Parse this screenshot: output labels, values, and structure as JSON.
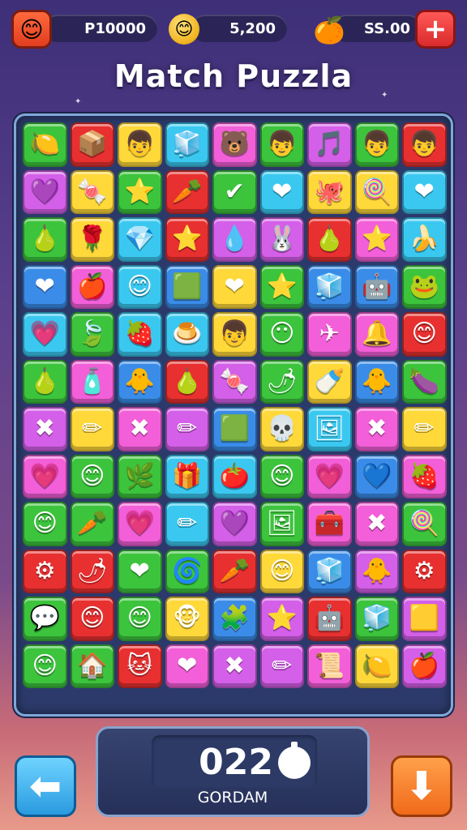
{
  "hud": {
    "avatar_icon": "smiley-face-icon",
    "score_label": "P10000",
    "coins_label": "5,200",
    "coin_icon": "smiley-coin-icon",
    "fruit_icon": "orange-fruit-icon",
    "currency_label": "SS.00",
    "plus_icon": "plus-icon"
  },
  "title": "Match Puzzla",
  "board": {
    "tiles": [
      {
        "color": "#3cc43c",
        "glyph": "🍋",
        "icon": "lemon-icon"
      },
      {
        "color": "#e83030",
        "glyph": "📦",
        "icon": "gift-box-icon"
      },
      {
        "color": "#ffd83a",
        "glyph": "👦",
        "icon": "boy-face-icon"
      },
      {
        "color": "#3ac8f0",
        "glyph": "🧊",
        "icon": "ice-cube-icon"
      },
      {
        "color": "#f25fd8",
        "glyph": "🐻",
        "icon": "bear-icon"
      },
      {
        "color": "#3cc43c",
        "glyph": "👦",
        "icon": "boy-face-icon"
      },
      {
        "color": "#d45fe8",
        "glyph": "🎵",
        "icon": "music-note-icon"
      },
      {
        "color": "#3cc43c",
        "glyph": "👦",
        "icon": "boy-face-icon"
      },
      {
        "color": "#e83030",
        "glyph": "👦",
        "icon": "boy-face-icon"
      },
      {
        "color": "#d45fe8",
        "glyph": "💜",
        "icon": "purple-heart-icon"
      },
      {
        "color": "#ffd83a",
        "glyph": "🍬",
        "icon": "candy-icon"
      },
      {
        "color": "#3cc43c",
        "glyph": "⭐",
        "icon": "star-icon"
      },
      {
        "color": "#e83030",
        "glyph": "🥕",
        "icon": "carrot-icon"
      },
      {
        "color": "#3cc43c",
        "glyph": "✔",
        "icon": "check-icon"
      },
      {
        "color": "#3ac8f0",
        "glyph": "❤",
        "icon": "heart-icon"
      },
      {
        "color": "#ffd83a",
        "glyph": "🐙",
        "icon": "octopus-icon"
      },
      {
        "color": "#ffd83a",
        "glyph": "🍭",
        "icon": "lollipop-icon"
      },
      {
        "color": "#3ac8f0",
        "glyph": "❤",
        "icon": "heart-icon"
      },
      {
        "color": "#3cc43c",
        "glyph": "🍐",
        "icon": "pear-icon",
        "tall": false
      },
      {
        "color": "#ffd83a",
        "glyph": "🌹",
        "icon": "flower-pot-icon"
      },
      {
        "color": "#3ac8f0",
        "glyph": "💎",
        "icon": "gem-icon"
      },
      {
        "color": "#e83030",
        "glyph": "⭐",
        "icon": "star-icon"
      },
      {
        "color": "#d45fe8",
        "glyph": "💧",
        "icon": "drop-icon"
      },
      {
        "color": "#d45fe8",
        "glyph": "🐰",
        "icon": "bunny-icon"
      },
      {
        "color": "#e83030",
        "glyph": "🍐",
        "icon": "pear-icon"
      },
      {
        "color": "#f25fd8",
        "glyph": "⭐",
        "icon": "star-icon"
      },
      {
        "color": "#3ac8f0",
        "glyph": "🍌",
        "icon": "banana-icon"
      },
      {
        "color": "#3a8ce8",
        "glyph": "❤",
        "icon": "heart-icon"
      },
      {
        "color": "#f25fd8",
        "glyph": "🍎",
        "icon": "apple-icon"
      },
      {
        "color": "#3ac8f0",
        "glyph": "😊",
        "icon": "smiley-face-icon"
      },
      {
        "color": "#3a8ce8",
        "glyph": "🟩",
        "icon": "square-icon"
      },
      {
        "color": "#ffd83a",
        "glyph": "❤",
        "icon": "heart-icon"
      },
      {
        "color": "#3cc43c",
        "glyph": "⭐",
        "icon": "star-icon"
      },
      {
        "color": "#3a8ce8",
        "glyph": "🧊",
        "icon": "cube-icon"
      },
      {
        "color": "#3a8ce8",
        "glyph": "🤖",
        "icon": "robot-face-icon"
      },
      {
        "color": "#3cc43c",
        "glyph": "🐸",
        "icon": "frog-icon"
      },
      {
        "color": "#3ac8f0",
        "glyph": "💗",
        "icon": "pink-heart-icon"
      },
      {
        "color": "#3cc43c",
        "glyph": "🍃",
        "icon": "leaf-icon"
      },
      {
        "color": "#3ac8f0",
        "glyph": "🍓",
        "icon": "strawberry-icon"
      },
      {
        "color": "#3ac8f0",
        "glyph": "🍮",
        "icon": "jelly-icon"
      },
      {
        "color": "#ffd83a",
        "glyph": "👦",
        "icon": "boy-face-icon"
      },
      {
        "color": "#3cc43c",
        "glyph": "😶",
        "icon": "block-face-icon"
      },
      {
        "color": "#f25fd8",
        "glyph": "✈",
        "icon": "paper-plane-icon"
      },
      {
        "color": "#f25fd8",
        "glyph": "🔔",
        "icon": "bell-icon"
      },
      {
        "color": "#e83030",
        "glyph": "😊",
        "icon": "smiley-face-icon"
      },
      {
        "color": "#3cc43c",
        "glyph": "🍐",
        "icon": "pear-icon"
      },
      {
        "color": "#f25fd8",
        "glyph": "🧴",
        "icon": "bottle-icon"
      },
      {
        "color": "#3a8ce8",
        "glyph": "🐥",
        "icon": "chick-icon"
      },
      {
        "color": "#e83030",
        "glyph": "🍐",
        "icon": "pear-icon"
      },
      {
        "color": "#d45fe8",
        "glyph": "🍬",
        "icon": "candy-icon"
      },
      {
        "color": "#3cc43c",
        "glyph": "🌶",
        "icon": "pepper-icon"
      },
      {
        "color": "#ffd83a",
        "glyph": "🍼",
        "icon": "bottle-icon"
      },
      {
        "color": "#3a8ce8",
        "glyph": "🐥",
        "icon": "chick-icon"
      },
      {
        "color": "#3cc43c",
        "glyph": "🍆",
        "icon": "eggplant-icon"
      },
      {
        "color": "#d45fe8",
        "glyph": "✖",
        "icon": "cross-icon"
      },
      {
        "color": "#ffd83a",
        "glyph": "✏",
        "icon": "pencil-icon"
      },
      {
        "color": "#f25fd8",
        "glyph": "✖",
        "icon": "cross-icon"
      },
      {
        "color": "#d45fe8",
        "glyph": "✏",
        "icon": "pencil-icon"
      },
      {
        "color": "#3a8ce8",
        "glyph": "🟩",
        "icon": "square-icon"
      },
      {
        "color": "#ffd83a",
        "glyph": "💀",
        "icon": "skull-icon"
      },
      {
        "color": "#3ac8f0",
        "glyph": "🖼",
        "icon": "picture-icon"
      },
      {
        "color": "#f25fd8",
        "glyph": "✖",
        "icon": "cross-icon"
      },
      {
        "color": "#ffd83a",
        "glyph": "✏",
        "icon": "pencil-icon"
      },
      {
        "color": "#f25fd8",
        "glyph": "💗",
        "icon": "pink-heart-icon"
      },
      {
        "color": "#3cc43c",
        "glyph": "😊",
        "icon": "smiley-face-icon"
      },
      {
        "color": "#3cc43c",
        "glyph": "🌿",
        "icon": "herb-icon"
      },
      {
        "color": "#3ac8f0",
        "glyph": "🎁",
        "icon": "gift-icon"
      },
      {
        "color": "#3ac8f0",
        "glyph": "🍅",
        "icon": "tomato-icon"
      },
      {
        "color": "#3cc43c",
        "glyph": "😊",
        "icon": "smiley-face-icon"
      },
      {
        "color": "#f25fd8",
        "glyph": "💗",
        "icon": "pink-heart-icon"
      },
      {
        "color": "#3a8ce8",
        "glyph": "💙",
        "icon": "blue-heart-icon"
      },
      {
        "color": "#f25fd8",
        "glyph": "🍓",
        "icon": "strawberry-icon"
      },
      {
        "color": "#3cc43c",
        "glyph": "😊",
        "icon": "smiley-face-icon"
      },
      {
        "color": "#3cc43c",
        "glyph": "🥕",
        "icon": "carrot-icon"
      },
      {
        "color": "#f25fd8",
        "glyph": "💗",
        "icon": "pink-heart-icon"
      },
      {
        "color": "#3ac8f0",
        "glyph": "✏",
        "icon": "pencil-icon"
      },
      {
        "color": "#d45fe8",
        "glyph": "💜",
        "icon": "purple-heart-icon"
      },
      {
        "color": "#3cc43c",
        "glyph": "🖼",
        "icon": "frame-icon"
      },
      {
        "color": "#f25fd8",
        "glyph": "🧰",
        "icon": "box-icon"
      },
      {
        "color": "#f25fd8",
        "glyph": "✖",
        "icon": "cross-icon"
      },
      {
        "color": "#3cc43c",
        "glyph": "🍭",
        "icon": "lollipop-icon"
      },
      {
        "color": "#e83030",
        "glyph": "⚙",
        "icon": "gear-icon"
      },
      {
        "color": "#e83030",
        "glyph": "🌶",
        "icon": "pepper-icon"
      },
      {
        "color": "#3cc43c",
        "glyph": "❤",
        "icon": "heart-icon"
      },
      {
        "color": "#3cc43c",
        "glyph": "🌀",
        "icon": "swirl-icon"
      },
      {
        "color": "#e83030",
        "glyph": "🥕",
        "icon": "carrot-icon"
      },
      {
        "color": "#ffd83a",
        "glyph": "😊",
        "icon": "smiley-face-icon"
      },
      {
        "color": "#3a8ce8",
        "glyph": "🧊",
        "icon": "cube-icon"
      },
      {
        "color": "#d45fe8",
        "glyph": "🐥",
        "icon": "chick-icon"
      },
      {
        "color": "#e83030",
        "glyph": "⚙",
        "icon": "gear-icon"
      },
      {
        "color": "#3cc43c",
        "glyph": "💬",
        "icon": "speech-bubble-icon"
      },
      {
        "color": "#e83030",
        "glyph": "😊",
        "icon": "smiley-face-icon"
      },
      {
        "color": "#3cc43c",
        "glyph": "😊",
        "icon": "smiley-face-icon"
      },
      {
        "color": "#ffd83a",
        "glyph": "🐵",
        "icon": "monkey-face-icon"
      },
      {
        "color": "#3a8ce8",
        "glyph": "🧩",
        "icon": "puzzle-icon"
      },
      {
        "color": "#d45fe8",
        "glyph": "⭐",
        "icon": "star-icon"
      },
      {
        "color": "#e83030",
        "glyph": "🤖",
        "icon": "robot-face-icon"
      },
      {
        "color": "#3cc43c",
        "glyph": "🧊",
        "icon": "cube-icon"
      },
      {
        "color": "#d45fe8",
        "glyph": "🟨",
        "icon": "box-icon"
      },
      {
        "color": "#3cc43c",
        "glyph": "😊",
        "icon": "smiley-face-icon"
      },
      {
        "color": "#3cc43c",
        "glyph": "🏠",
        "icon": "house-icon"
      },
      {
        "color": "#e83030",
        "glyph": "🐱",
        "icon": "cat-face-icon"
      },
      {
        "color": "#f25fd8",
        "glyph": "❤",
        "icon": "heart-icon"
      },
      {
        "color": "#d45fe8",
        "glyph": "✖",
        "icon": "cross-icon"
      },
      {
        "color": "#d45fe8",
        "glyph": "✏",
        "icon": "pencil-icon"
      },
      {
        "color": "#f25fd8",
        "glyph": "📜",
        "icon": "scroll-icon"
      },
      {
        "color": "#ffd83a",
        "glyph": "🍋",
        "icon": "lemon-icon"
      },
      {
        "color": "#d45fe8",
        "glyph": "🍎",
        "icon": "apple-icon"
      }
    ]
  },
  "bottom": {
    "score": "022",
    "label": "GORDAM",
    "timer_icon": "stopwatch-icon",
    "left_icon": "home-arrow-left-icon",
    "right_icon": "down-arrow-icon"
  }
}
